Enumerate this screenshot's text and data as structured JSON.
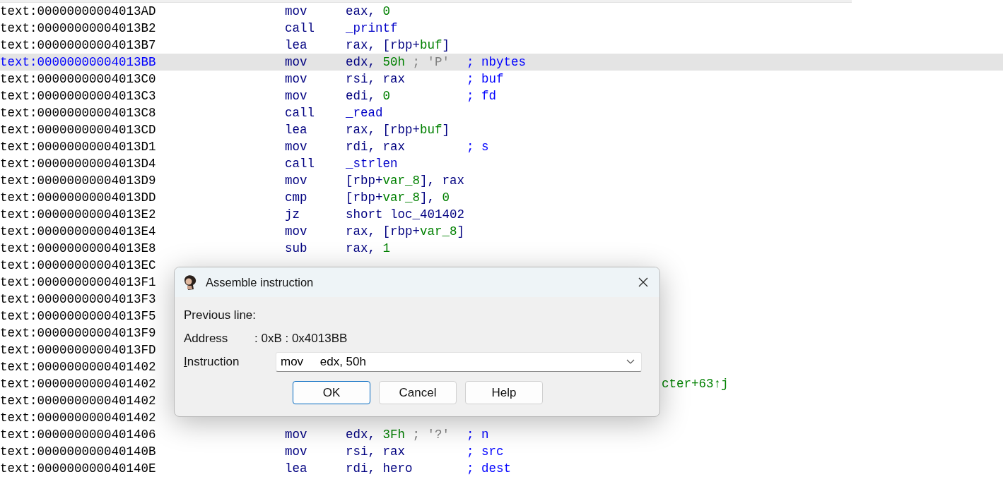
{
  "listing": [
    {
      "address": "text:00000000004013AD",
      "selected": false,
      "mnemonic": "mov",
      "operands": [
        {
          "text": "eax, ",
          "kind": "plain"
        },
        {
          "text": "0",
          "kind": "num"
        }
      ]
    },
    {
      "address": "text:00000000004013B2",
      "selected": false,
      "mnemonic": "call",
      "operands": [
        {
          "text": "_printf",
          "kind": "func"
        }
      ]
    },
    {
      "address": "text:00000000004013B7",
      "selected": false,
      "mnemonic": "lea",
      "operands": [
        {
          "text": "rax, [rbp+",
          "kind": "plain"
        },
        {
          "text": "buf",
          "kind": "num"
        },
        {
          "text": "]",
          "kind": "plain"
        }
      ]
    },
    {
      "address": "text:00000000004013BB",
      "selected": true,
      "mnemonic": "mov",
      "operands": [
        {
          "text": "edx, ",
          "kind": "plain"
        },
        {
          "text": "50h",
          "kind": "num"
        },
        {
          "text": " ; 'P'",
          "kind": "note"
        }
      ],
      "comment": "; nbytes"
    },
    {
      "address": "text:00000000004013C0",
      "selected": false,
      "mnemonic": "mov",
      "operands": [
        {
          "text": "rsi, rax",
          "kind": "plain"
        }
      ],
      "comment": "; buf"
    },
    {
      "address": "text:00000000004013C3",
      "selected": false,
      "mnemonic": "mov",
      "operands": [
        {
          "text": "edi, ",
          "kind": "plain"
        },
        {
          "text": "0",
          "kind": "num"
        }
      ],
      "comment": "; fd"
    },
    {
      "address": "text:00000000004013C8",
      "selected": false,
      "mnemonic": "call",
      "operands": [
        {
          "text": "_read",
          "kind": "func"
        }
      ]
    },
    {
      "address": "text:00000000004013CD",
      "selected": false,
      "mnemonic": "lea",
      "operands": [
        {
          "text": "rax, [rbp+",
          "kind": "plain"
        },
        {
          "text": "buf",
          "kind": "num"
        },
        {
          "text": "]",
          "kind": "plain"
        }
      ]
    },
    {
      "address": "text:00000000004013D1",
      "selected": false,
      "mnemonic": "mov",
      "operands": [
        {
          "text": "rdi, rax",
          "kind": "plain"
        }
      ],
      "comment": "; s"
    },
    {
      "address": "text:00000000004013D4",
      "selected": false,
      "mnemonic": "call",
      "operands": [
        {
          "text": "_strlen",
          "kind": "func"
        }
      ]
    },
    {
      "address": "text:00000000004013D9",
      "selected": false,
      "mnemonic": "mov",
      "operands": [
        {
          "text": "[rbp+",
          "kind": "plain"
        },
        {
          "text": "var_8",
          "kind": "num"
        },
        {
          "text": "], rax",
          "kind": "plain"
        }
      ]
    },
    {
      "address": "text:00000000004013DD",
      "selected": false,
      "mnemonic": "cmp",
      "operands": [
        {
          "text": "[rbp+",
          "kind": "plain"
        },
        {
          "text": "var_8",
          "kind": "num"
        },
        {
          "text": "], ",
          "kind": "plain"
        },
        {
          "text": "0",
          "kind": "num"
        }
      ]
    },
    {
      "address": "text:00000000004013E2",
      "selected": false,
      "mnemonic": "jz",
      "operands": [
        {
          "text": "short loc_401402",
          "kind": "plain"
        }
      ]
    },
    {
      "address": "text:00000000004013E4",
      "selected": false,
      "mnemonic": "mov",
      "operands": [
        {
          "text": "rax, [rbp+",
          "kind": "plain"
        },
        {
          "text": "var_8",
          "kind": "num"
        },
        {
          "text": "]",
          "kind": "plain"
        }
      ]
    },
    {
      "address": "text:00000000004013E8",
      "selected": false,
      "mnemonic": "sub",
      "operands": [
        {
          "text": "rax, ",
          "kind": "plain"
        },
        {
          "text": "1",
          "kind": "num"
        }
      ]
    },
    {
      "address": "text:00000000004013EC",
      "selected": false
    },
    {
      "address": "text:00000000004013F1",
      "selected": false
    },
    {
      "address": "text:00000000004013F3",
      "selected": false
    },
    {
      "address": "text:00000000004013F5",
      "selected": false
    },
    {
      "address": "text:00000000004013F9",
      "selected": false
    },
    {
      "address": "text:00000000004013FD",
      "selected": false
    },
    {
      "address": "text:0000000000401402",
      "selected": false
    },
    {
      "address": "text:0000000000401402",
      "selected": false,
      "xref": "cter+63↑j"
    },
    {
      "address": "text:0000000000401402",
      "selected": false
    },
    {
      "address": "text:0000000000401402",
      "selected": false
    },
    {
      "address": "text:0000000000401406",
      "selected": false,
      "mnemonic": "mov",
      "operands": [
        {
          "text": "edx, ",
          "kind": "plain"
        },
        {
          "text": "3Fh",
          "kind": "num"
        },
        {
          "text": " ; '?'",
          "kind": "note"
        }
      ],
      "comment": "; n"
    },
    {
      "address": "text:000000000040140B",
      "selected": false,
      "mnemonic": "mov",
      "operands": [
        {
          "text": "rsi, rax",
          "kind": "plain"
        }
      ],
      "comment": "; src"
    },
    {
      "address": "text:000000000040140E",
      "selected": false,
      "mnemonic": "lea",
      "operands": [
        {
          "text": "rdi, hero",
          "kind": "plain"
        }
      ],
      "comment": "; dest"
    }
  ],
  "dialog": {
    "title": "Assemble instruction",
    "heading": "Previous line:",
    "address_label": "Address",
    "address_value": ": 0xB : 0x4013BB",
    "instruction_label": "Instruction",
    "instruction_value": "mov     edx, 50h",
    "buttons": [
      {
        "label": "OK",
        "focused": true
      },
      {
        "label": "Cancel",
        "focused": false
      },
      {
        "label": "Help",
        "focused": false
      }
    ]
  }
}
